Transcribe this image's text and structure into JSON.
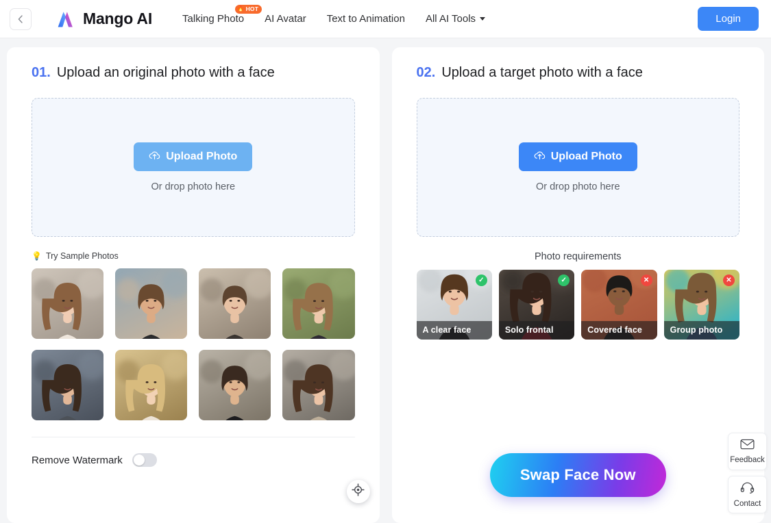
{
  "header": {
    "back_icon": "chevron-left-icon",
    "brand_name": "Mango AI",
    "brand_logo_icon": "mango-ai-logo",
    "nav": [
      {
        "label": "Talking Photo",
        "badge": "HOT",
        "badge_icon": "flame-icon",
        "has_caret": false
      },
      {
        "label": "AI Avatar",
        "has_caret": false
      },
      {
        "label": "Text to Animation",
        "has_caret": false
      },
      {
        "label": "All AI Tools",
        "has_caret": true
      }
    ],
    "login_label": "Login"
  },
  "left_panel": {
    "step": "01.",
    "title": "Upload an original photo with a face",
    "upload_button_label": "Upload Photo",
    "upload_button_icon": "cloud-upload-icon",
    "drop_hint": "Or drop photo here",
    "samples_label": "Try Sample Photos",
    "samples_icon": "lightbulb-icon",
    "samples": [
      {
        "alt": "Woman with long wavy brown hair in white top"
      },
      {
        "alt": "Man with curly hair on hillside town"
      },
      {
        "alt": "Woman in black tee on city street"
      },
      {
        "alt": "Woman in floral dress in a field"
      },
      {
        "alt": "Woman with grey scarf on city street"
      },
      {
        "alt": "Blonde woman in white tee at sunset"
      },
      {
        "alt": "Man in black coat among bare trees"
      },
      {
        "alt": "Woman in beige trench coat"
      }
    ],
    "locate_icon": "crosshair-target-icon",
    "watermark_label": "Remove Watermark",
    "watermark_on": false
  },
  "right_panel": {
    "step": "02.",
    "title": "Upload a target photo with a face",
    "upload_button_label": "Upload Photo",
    "upload_button_icon": "cloud-upload-icon",
    "drop_hint": "Or drop photo here",
    "requirements_title": "Photo requirements",
    "requirements": [
      {
        "caption": "A clear face",
        "status": "ok",
        "badge_icon": "check-circle-icon"
      },
      {
        "caption": "Solo frontal",
        "status": "ok",
        "badge_icon": "check-circle-icon"
      },
      {
        "caption": "Covered face",
        "status": "bad",
        "badge_icon": "x-circle-icon"
      },
      {
        "caption": "Group photo",
        "status": "bad",
        "badge_icon": "x-circle-icon"
      }
    ],
    "swap_button_label": "Swap Face Now"
  },
  "side_widgets": [
    {
      "label": "Feedback",
      "icon": "envelope-icon"
    },
    {
      "label": "Contact",
      "icon": "headset-icon"
    }
  ],
  "colors": {
    "accent_blue": "#3c87f7",
    "upload_light_blue": "#6db2f2",
    "step_number": "#4a72f0",
    "hot_badge": "#f86a2c",
    "status_ok": "#2ec36a",
    "status_bad": "#f0473f",
    "page_bg": "#f4f5f7"
  }
}
